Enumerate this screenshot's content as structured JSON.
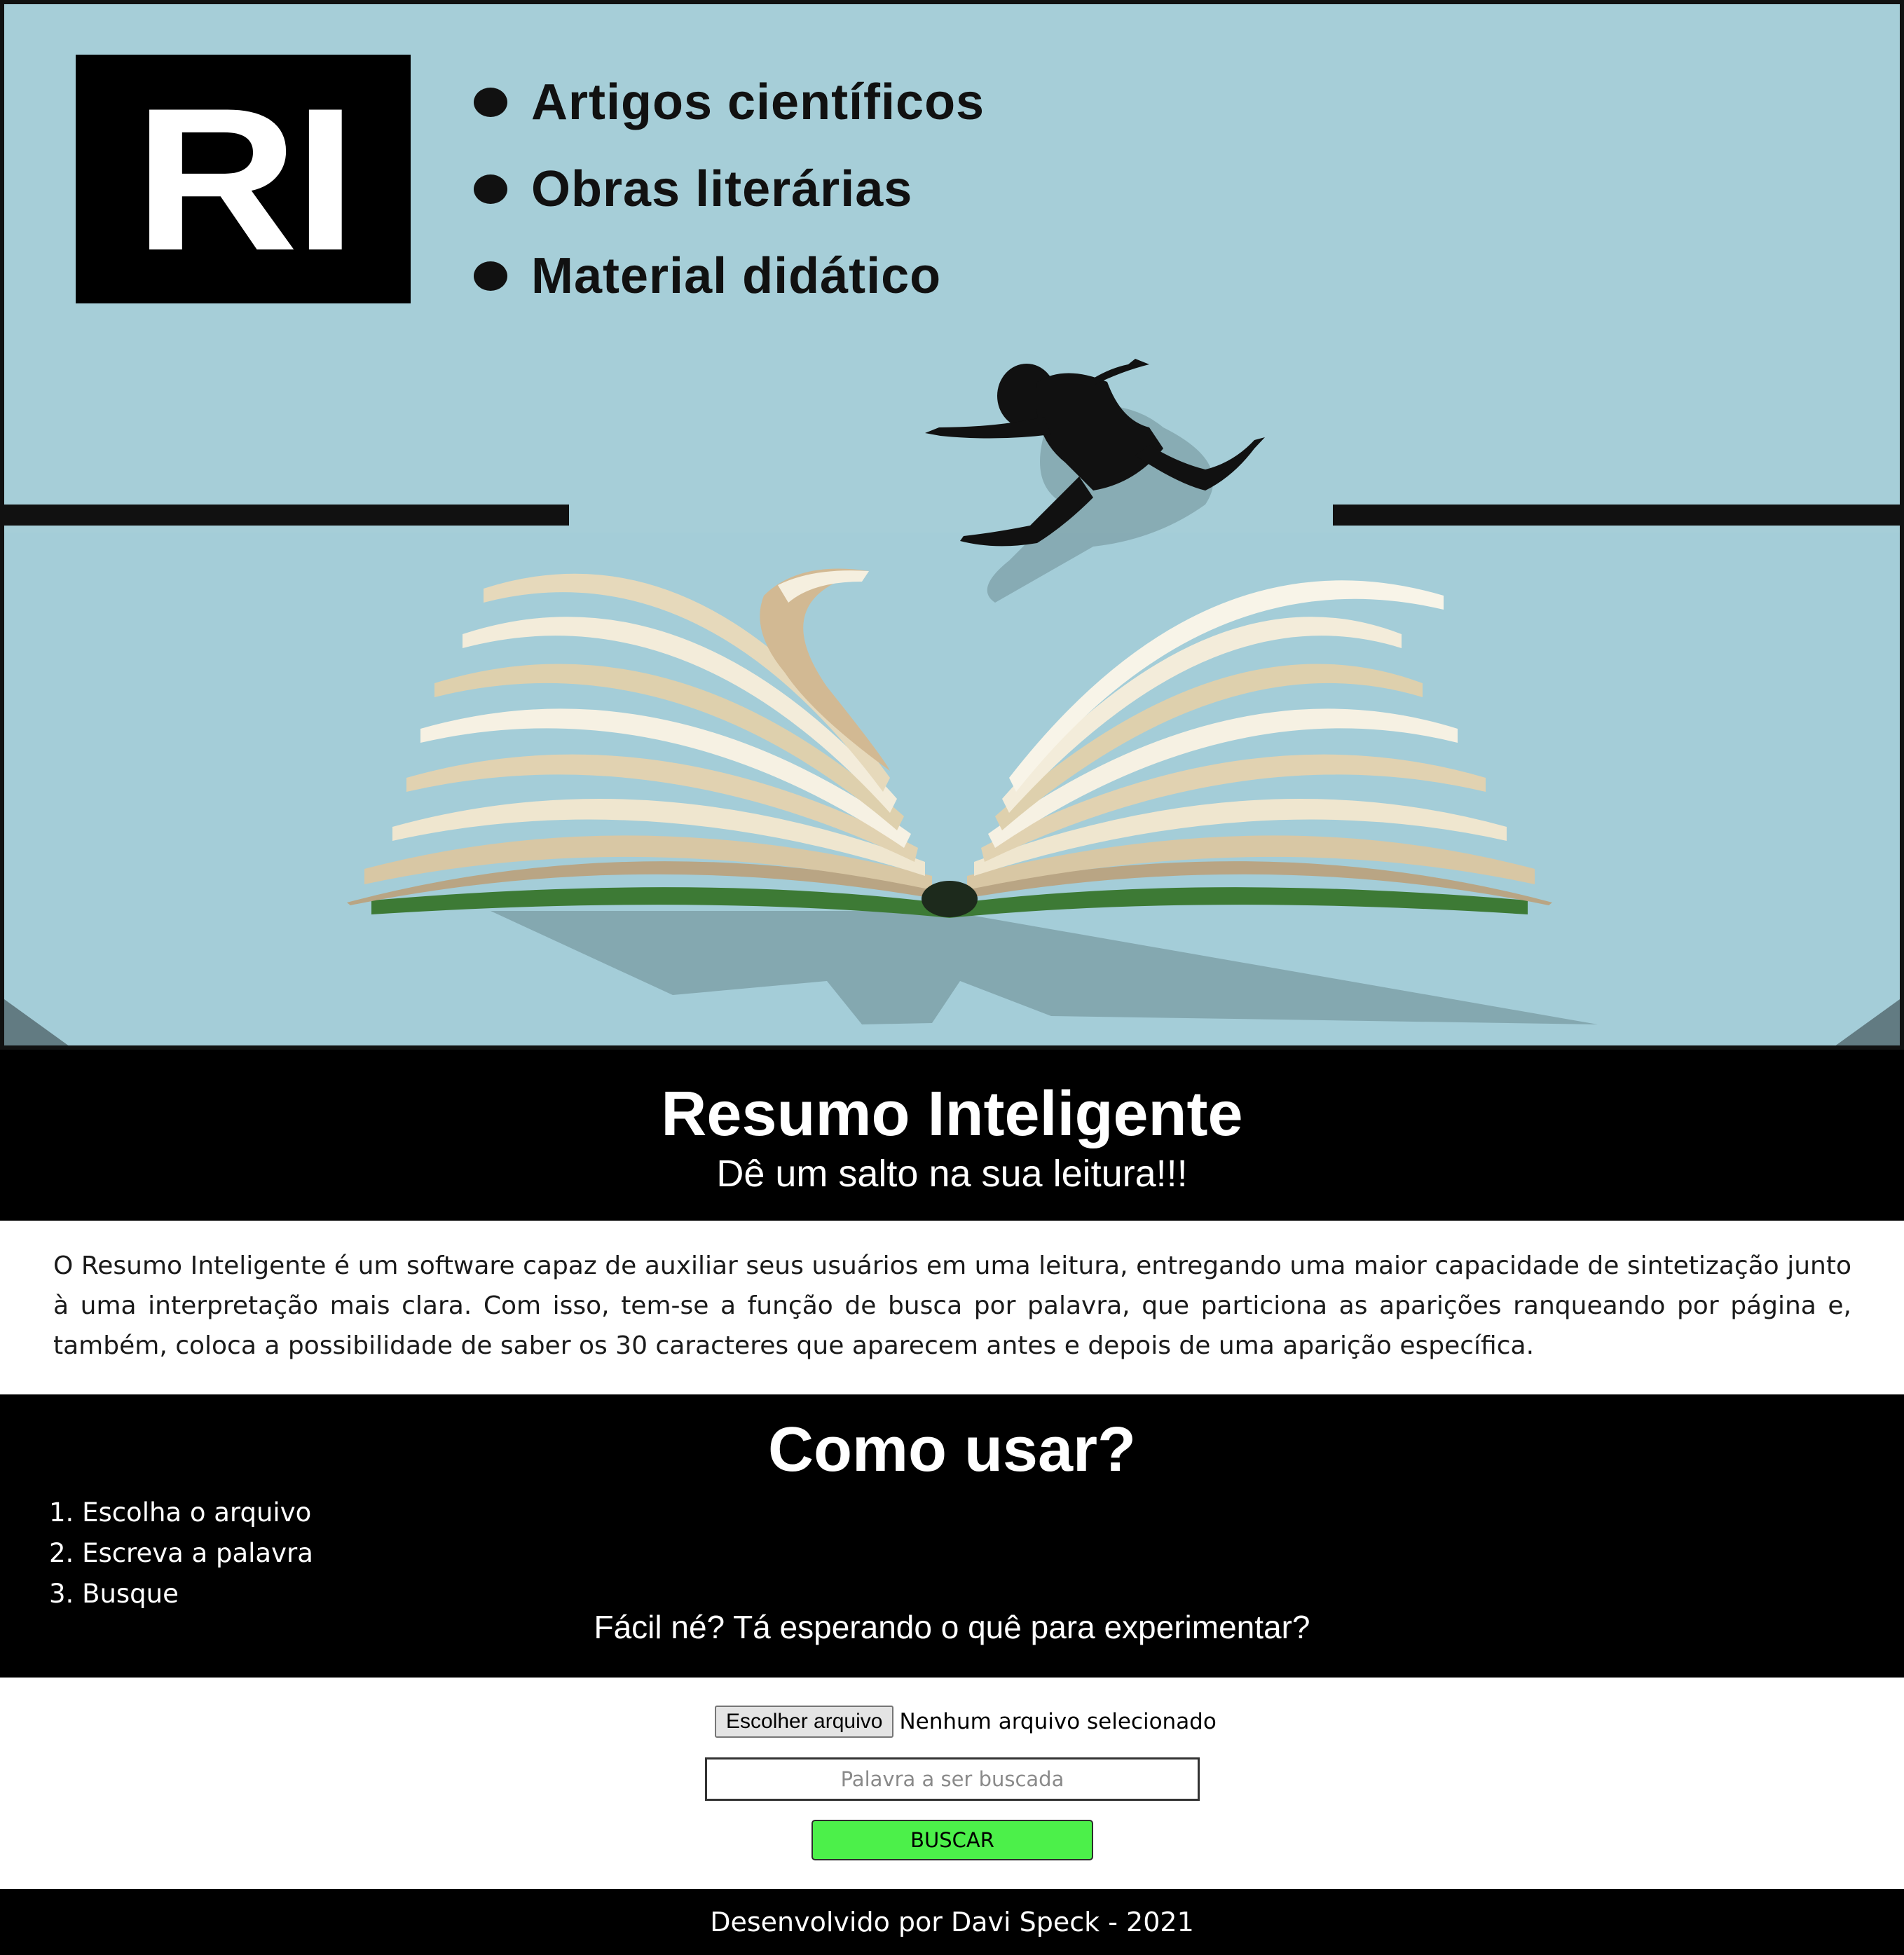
{
  "hero": {
    "logo_text": "RI",
    "features": [
      "Artigos científicos",
      "Obras literárias",
      "Material didático"
    ],
    "colors": {
      "sky": "#a6ced8",
      "book_pages": "#efe6cf",
      "book_cover": "#3d7a35",
      "silhouette": "#111111"
    }
  },
  "title_band": {
    "title": "Resumo Inteligente",
    "tagline": "Dê um salto na sua leitura!!!"
  },
  "description": "O Resumo Inteligente é um software capaz de auxiliar seus usuários em uma leitura, entregando uma maior capacidade de sintetização junto à uma interpretação mais clara. Com isso, tem-se a função de busca por palavra, que particiona as aparições ranqueando por página e, também, coloca a possibilidade de saber os 30 caracteres que aparecem antes e depois de uma aparição específica.",
  "howto": {
    "title": "Como usar?",
    "steps": [
      "1. Escolha o arquivo",
      "2. Escreva a palavra",
      "3. Busque"
    ],
    "cta": "Fácil né? Tá esperando o quê para experimentar?"
  },
  "form": {
    "file_button_label": "Escolher arquivo",
    "file_status": "Nenhum arquivo selecionado",
    "search_placeholder": "Palavra a ser buscada",
    "search_value": "",
    "submit_label": "BUSCAR",
    "submit_color": "#4cf04a"
  },
  "footer": {
    "text": "Desenvolvido por Davi Speck - 2021"
  }
}
